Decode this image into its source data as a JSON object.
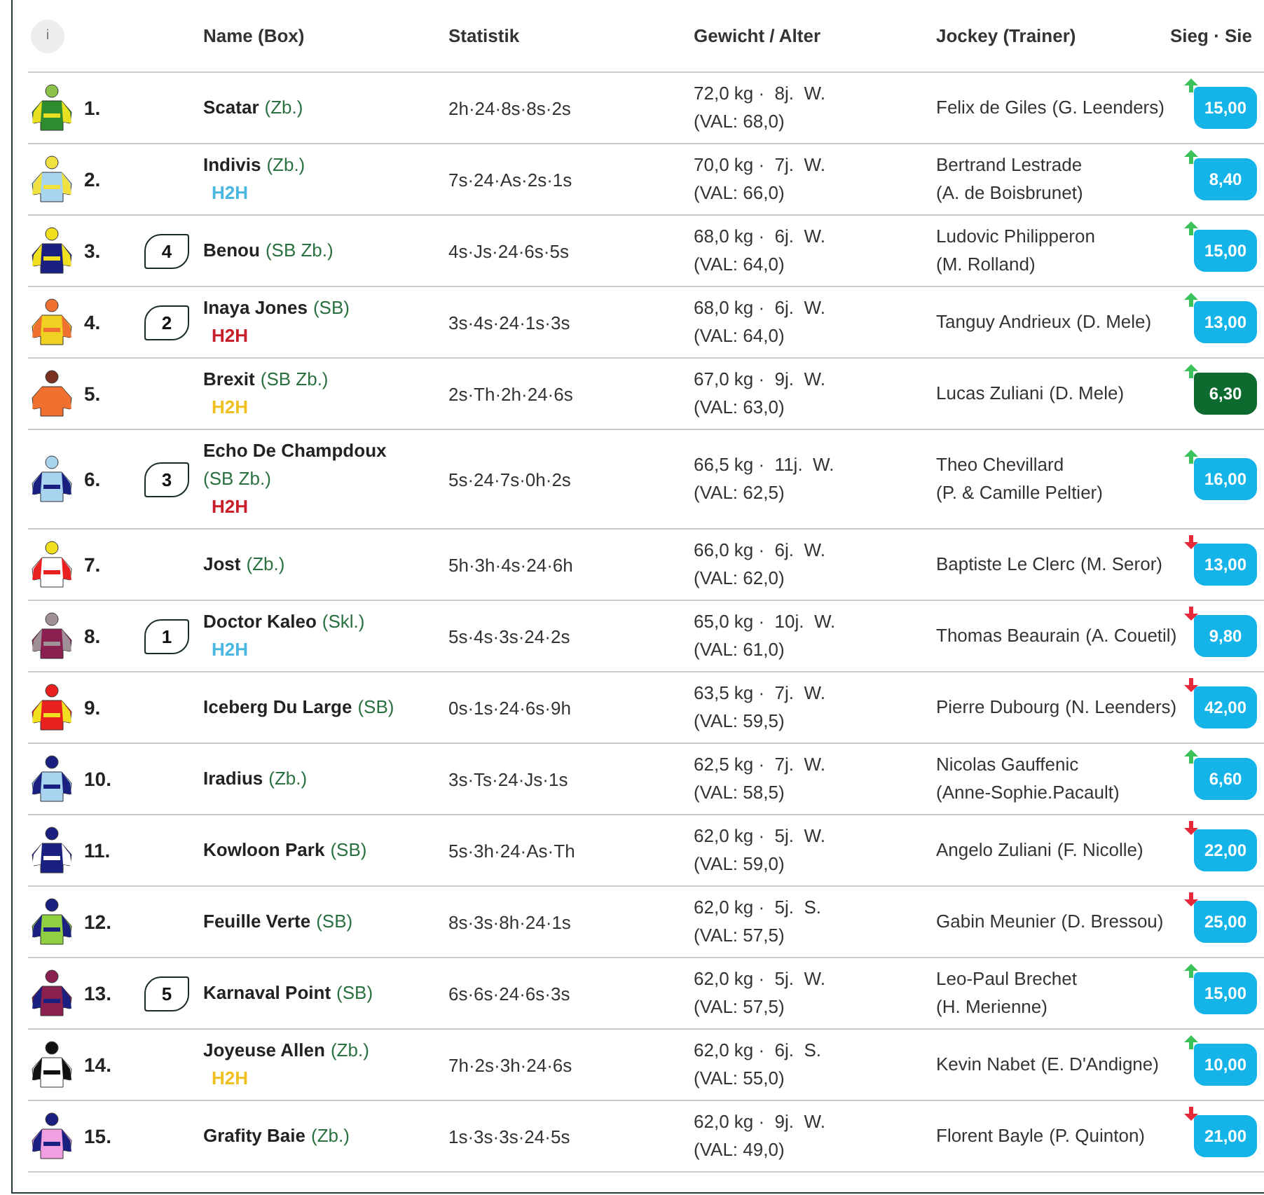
{
  "header": {
    "info": "i",
    "columns": [
      "Name (Box)",
      "Statistik",
      "Gewicht / Alter",
      "Jockey  (Trainer)",
      "Sieg · Sie"
    ]
  },
  "runners": [
    {
      "number": "1.",
      "silk": [
        {
          "kind": "cap",
          "color": "#8bc34a"
        },
        {
          "kind": "body",
          "color": "#2e8b2e"
        },
        {
          "kind": "sleeves",
          "color": "#e8e020"
        }
      ],
      "name": "Scatar",
      "box": "(Zb.)",
      "stats": "2h·24·8s·8s·2s",
      "weight": "72,0 kg ·  8j.  W.",
      "val": "(VAL: 68,0)",
      "jockey": "Felix de Giles",
      "trainer": "(G. Leenders)",
      "rising": true,
      "odds": "15,00",
      "favorite": false
    },
    {
      "number": "2.",
      "silk": [
        {
          "kind": "cap",
          "color": "#f0e040"
        },
        {
          "kind": "body",
          "color": "#a8d4f0"
        },
        {
          "kind": "sleeves",
          "color": "#f0e040"
        }
      ],
      "name": "Indivis",
      "box": "(Zb.)",
      "h2h": {
        "text": "H2H",
        "color": "#4ab8e0"
      },
      "stats": "7s·24·As·2s·1s",
      "weight": "70,0 kg ·  7j.  W.",
      "val": "(VAL: 66,0)",
      "jockey": "Bertrand Lestrade",
      "trainer": "(A. de Boisbrunet)",
      "rising": true,
      "odds": "8,40",
      "favorite": false
    },
    {
      "number": "3.",
      "silk": [
        {
          "kind": "cap",
          "color": "#f0e020"
        },
        {
          "kind": "body",
          "color": "#1a2080"
        },
        {
          "kind": "sleeves",
          "color": "#f0e020"
        }
      ],
      "draw": "4",
      "name": "Benou",
      "box": "(SB Zb.)",
      "stats": "4s·Js·24·6s·5s",
      "weight": "68,0 kg ·  6j.  W.",
      "val": "(VAL: 64,0)",
      "jockey": "Ludovic Philipperon",
      "trainer": "(M. Rolland)",
      "rising": true,
      "odds": "15,00",
      "favorite": false
    },
    {
      "number": "4.",
      "silk": [
        {
          "kind": "cap",
          "color": "#f07030"
        },
        {
          "kind": "body",
          "color": "#f0d020"
        },
        {
          "kind": "sleeves",
          "color": "#f07030"
        }
      ],
      "draw": "2",
      "name": "Inaya Jones",
      "box": "(SB)",
      "h2h": {
        "text": "H2H",
        "color": "#c8202a"
      },
      "stats": "3s·4s·24·1s·3s",
      "weight": "68,0 kg ·  6j.  W.",
      "val": "(VAL: 64,0)",
      "jockey": "Tanguy Andrieux",
      "trainer": "(D. Mele)",
      "rising": true,
      "odds": "13,00",
      "favorite": false
    },
    {
      "number": "5.",
      "silk": [
        {
          "kind": "cap",
          "color": "#7a3020"
        },
        {
          "kind": "body",
          "color": "#f07030"
        },
        {
          "kind": "sleeves",
          "color": "#f07030"
        }
      ],
      "name": "Brexit",
      "box": "(SB Zb.)",
      "h2h": {
        "text": "H2H",
        "color": "#f0c020"
      },
      "stats": "2s·Th·2h·24·6s",
      "weight": "67,0 kg ·  9j.  W.",
      "val": "(VAL: 63,0)",
      "jockey": "Lucas Zuliani",
      "trainer": "(D. Mele)",
      "rising": true,
      "odds": "6,30",
      "favorite": true
    },
    {
      "number": "6.",
      "silk": [
        {
          "kind": "cap",
          "color": "#a8d4f0"
        },
        {
          "kind": "body",
          "color": "#a8d4f0"
        },
        {
          "kind": "sleeves",
          "color": "#1a2080"
        }
      ],
      "draw": "3",
      "name": "Echo De Champdoux",
      "box": "(SB Zb.)",
      "h2h": {
        "text": "H2H",
        "color": "#c8202a"
      },
      "stats": "5s·24·7s·0h·2s",
      "weight": "66,5 kg ·  11j.  W.",
      "val": "(VAL: 62,5)",
      "jockey": "Theo Chevillard",
      "trainer": "(P. & Camille Peltier)",
      "rising": true,
      "odds": "16,00",
      "favorite": false
    },
    {
      "number": "7.",
      "silk": [
        {
          "kind": "cap",
          "color": "#f0e020"
        },
        {
          "kind": "body",
          "color": "#ffffff"
        },
        {
          "kind": "sleeves",
          "color": "#e82020"
        }
      ],
      "name": "Jost",
      "box": "(Zb.)",
      "stats": "5h·3h·4s·24·6h",
      "weight": "66,0 kg ·  6j.  W.",
      "val": "(VAL: 62,0)",
      "jockey": "Baptiste Le Clerc",
      "trainer": "(M. Seror)",
      "rising": false,
      "odds": "13,00",
      "favorite": false
    },
    {
      "number": "8.",
      "silk": [
        {
          "kind": "cap",
          "color": "#a09098"
        },
        {
          "kind": "body",
          "color": "#8a2050"
        },
        {
          "kind": "sleeves",
          "color": "#a09098"
        }
      ],
      "draw": "1",
      "name": "Doctor Kaleo",
      "box": "(Skl.)",
      "h2h": {
        "text": "H2H",
        "color": "#4ab8e0"
      },
      "stats": "5s·4s·3s·24·2s",
      "weight": "65,0 kg ·  10j.  W.",
      "val": "(VAL: 61,0)",
      "jockey": "Thomas Beaurain",
      "trainer": "(A. Couetil)",
      "rising": false,
      "odds": "9,80",
      "favorite": false
    },
    {
      "number": "9.",
      "silk": [
        {
          "kind": "cap",
          "color": "#e82020"
        },
        {
          "kind": "body",
          "color": "#e82020"
        },
        {
          "kind": "sleeves",
          "color": "#f0e020"
        }
      ],
      "name": "Iceberg Du Large",
      "box": "(SB)",
      "stats": "0s·1s·24·6s·9h",
      "weight": "63,5 kg ·  7j.  W.",
      "val": "(VAL: 59,5)",
      "jockey": "Pierre Dubourg",
      "trainer": "(N. Leenders)",
      "rising": false,
      "odds": "42,00",
      "favorite": false
    },
    {
      "number": "10.",
      "silk": [
        {
          "kind": "cap",
          "color": "#1a2080"
        },
        {
          "kind": "body",
          "color": "#a8d4f0"
        },
        {
          "kind": "sleeves",
          "color": "#1a2080"
        }
      ],
      "name": "Iradius",
      "box": "(Zb.)",
      "stats": "3s·Ts·24·Js·1s",
      "weight": "62,5 kg ·  7j.  W.",
      "val": "(VAL: 58,5)",
      "jockey": "Nicolas Gauffenic",
      "trainer": "(Anne-Sophie.Pacault)",
      "rising": true,
      "odds": "6,60",
      "favorite": false
    },
    {
      "number": "11.",
      "silk": [
        {
          "kind": "cap",
          "color": "#1a2080"
        },
        {
          "kind": "body",
          "color": "#1a2080"
        },
        {
          "kind": "sleeves",
          "color": "#ffffff"
        }
      ],
      "name": "Kowloon Park",
      "box": "(SB)",
      "stats": "5s·3h·24·As·Th",
      "weight": "62,0 kg ·  5j.  W.",
      "val": "(VAL: 59,0)",
      "jockey": "Angelo Zuliani",
      "trainer": "(F. Nicolle)",
      "rising": false,
      "odds": "22,00",
      "favorite": false
    },
    {
      "number": "12.",
      "silk": [
        {
          "kind": "cap",
          "color": "#1a2080"
        },
        {
          "kind": "body",
          "color": "#90d040"
        },
        {
          "kind": "sleeves",
          "color": "#1a2080"
        }
      ],
      "name": "Feuille Verte",
      "box": "(SB)",
      "stats": "8s·3s·8h·24·1s",
      "weight": "62,0 kg ·  5j.  S.",
      "val": "(VAL: 57,5)",
      "jockey": "Gabin Meunier",
      "trainer": "(D. Bressou)",
      "rising": false,
      "odds": "25,00",
      "favorite": false
    },
    {
      "number": "13.",
      "silk": [
        {
          "kind": "cap",
          "color": "#8a2050"
        },
        {
          "kind": "body",
          "color": "#8a2050"
        },
        {
          "kind": "sleeves",
          "color": "#1a2080"
        }
      ],
      "draw": "5",
      "name": "Karnaval Point",
      "box": "(SB)",
      "stats": "6s·6s·24·6s·3s",
      "weight": "62,0 kg ·  5j.  W.",
      "val": "(VAL: 57,5)",
      "jockey": "Leo-Paul Brechet",
      "trainer": "(H. Merienne)",
      "rising": true,
      "odds": "15,00",
      "favorite": false
    },
    {
      "number": "14.",
      "silk": [
        {
          "kind": "cap",
          "color": "#111111"
        },
        {
          "kind": "body",
          "color": "#ffffff"
        },
        {
          "kind": "sleeves",
          "color": "#111111"
        }
      ],
      "name": "Joyeuse Allen",
      "box": "(Zb.)",
      "h2h": {
        "text": "H2H",
        "color": "#f0c020"
      },
      "stats": "7h·2s·3h·24·6s",
      "weight": "62,0 kg ·  6j.  S.",
      "val": "(VAL: 55,0)",
      "jockey": "Kevin Nabet",
      "trainer": "(E. D'Andigne)",
      "rising": true,
      "odds": "10,00",
      "favorite": false
    },
    {
      "number": "15.",
      "silk": [
        {
          "kind": "cap",
          "color": "#1a2080"
        },
        {
          "kind": "body",
          "color": "#f0a0e0"
        },
        {
          "kind": "sleeves",
          "color": "#1a2080"
        }
      ],
      "name": "Grafity Baie",
      "box": "(Zb.)",
      "stats": "1s·3s·3s·24·5s",
      "weight": "62,0 kg ·  9j.  W.",
      "val": "(VAL: 49,0)",
      "jockey": "Florent Bayle",
      "trainer": "(P. Quinton)",
      "rising": false,
      "odds": "21,00",
      "favorite": false
    }
  ]
}
